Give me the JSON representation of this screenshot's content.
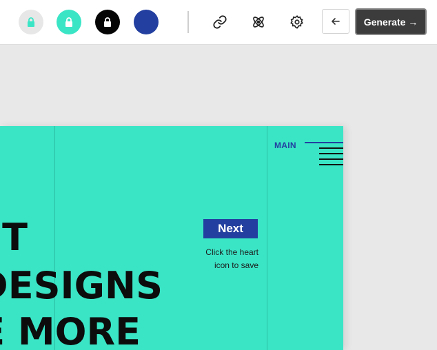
{
  "toolbar": {
    "swatches": [
      {
        "name": "swatch-light",
        "color": "#e7e7e7",
        "lock_color": "#3ae5c6"
      },
      {
        "name": "swatch-teal",
        "color": "#3ae5c6",
        "lock_color": "#ffffff"
      },
      {
        "name": "swatch-black",
        "color": "#050505",
        "lock_color": "#ffffff"
      },
      {
        "name": "swatch-blue",
        "color": "#2340a0",
        "lock_color": null
      }
    ],
    "tools": [
      "link-icon",
      "atom-icon",
      "gear-icon"
    ],
    "back_icon": "arrow-left-icon",
    "generate_label": "Generate →"
  },
  "canvas": {
    "background": "#3ae5c6",
    "brand": "MAIN",
    "menu_icon": "hamburger-menu-icon",
    "next_label": "Next",
    "hint_line1": "Click the heart",
    "hint_line2": "icon to save",
    "headline_line1": "T",
    "headline_line2": "DESIGNS",
    "headline_line3": "E MORE"
  }
}
